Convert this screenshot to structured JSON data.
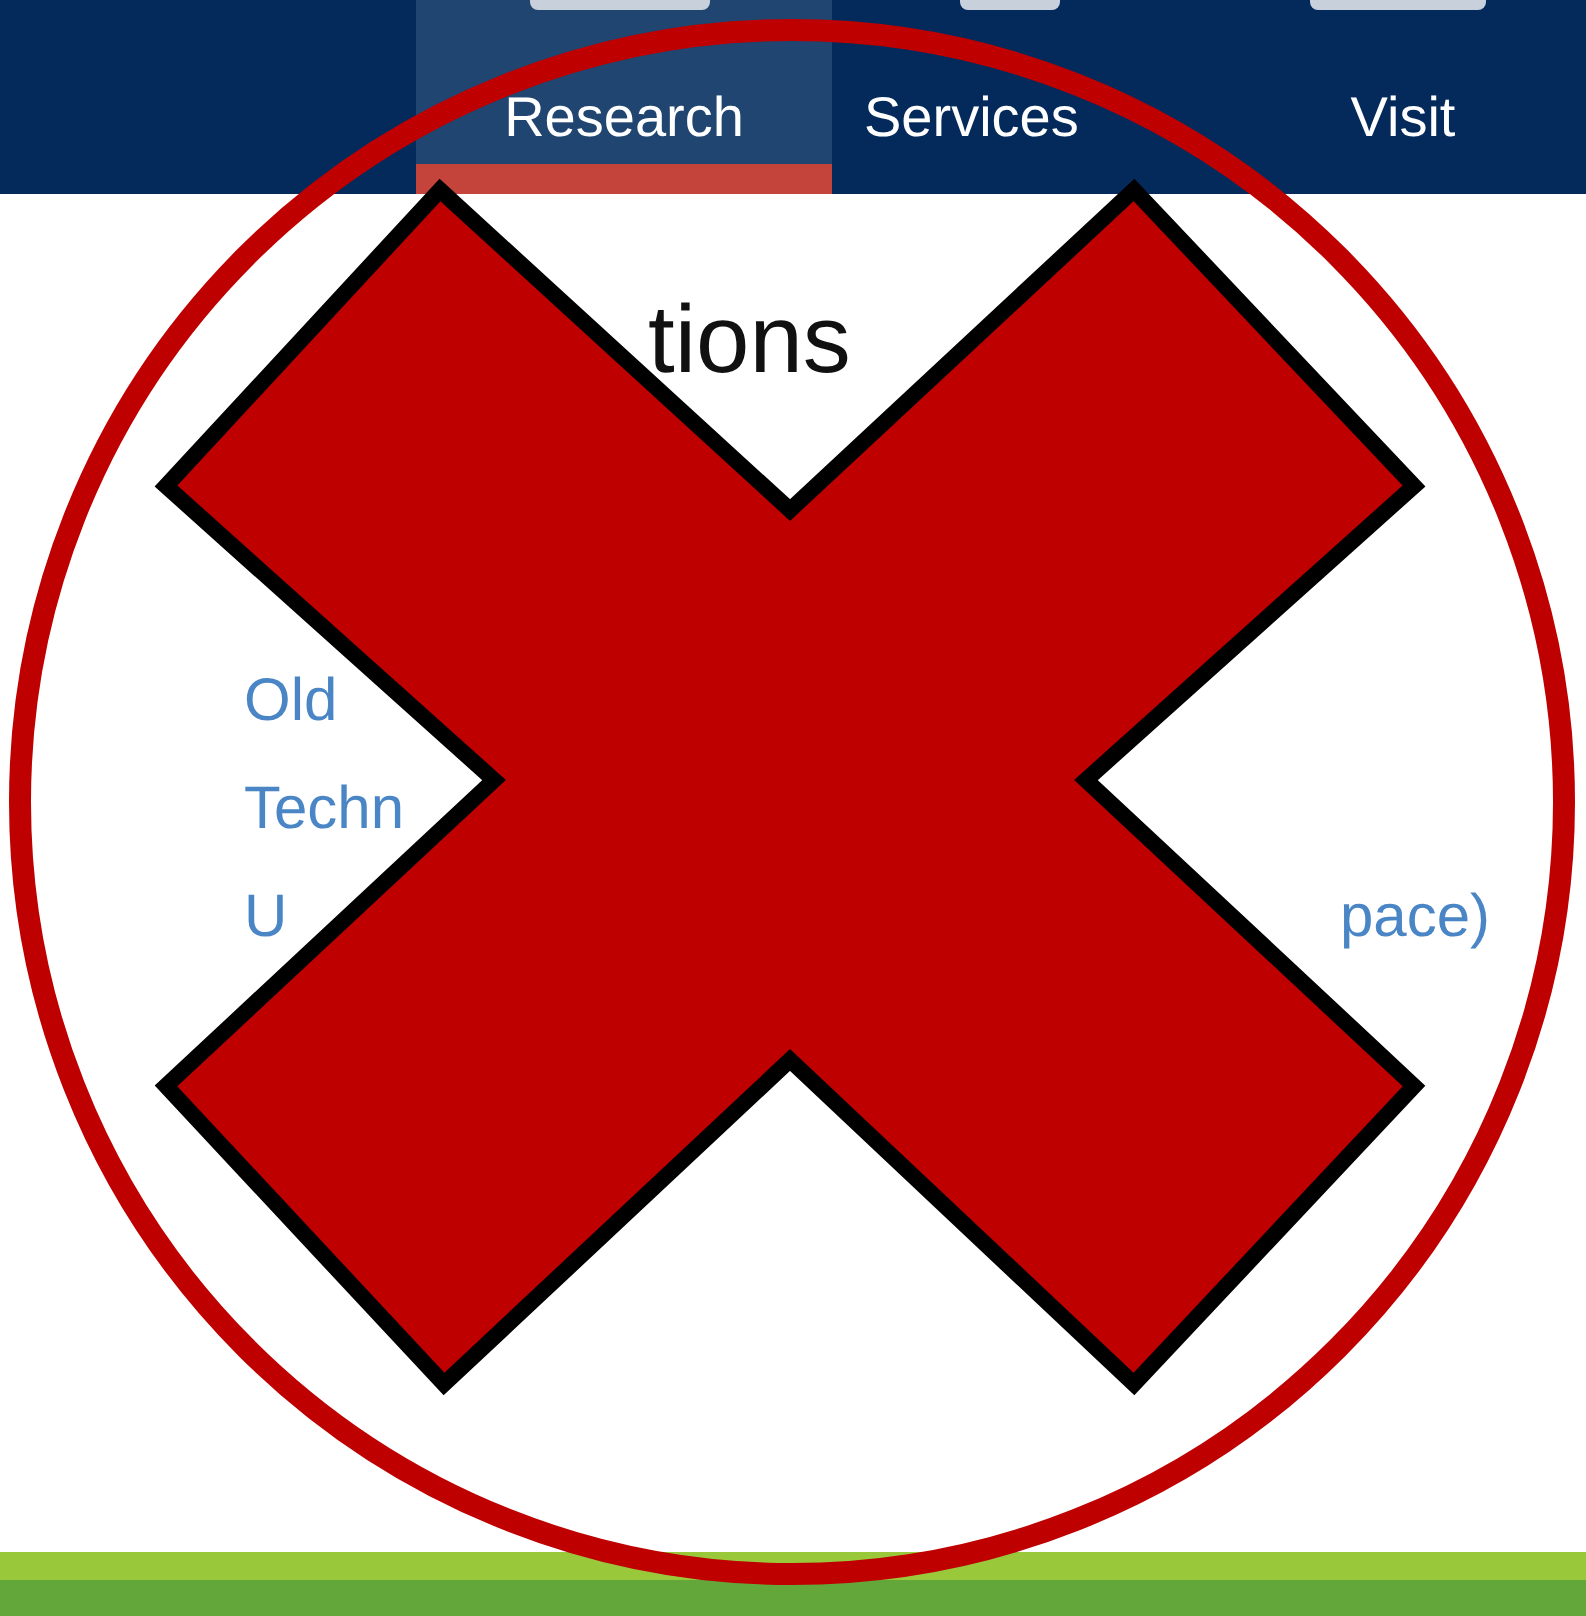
{
  "nav": [
    {
      "label": "Research",
      "selected": true
    },
    {
      "label": "Services",
      "selected": false
    },
    {
      "label": "Visit",
      "selected": false
    }
  ],
  "heading": "tions",
  "links": [
    {
      "parts": [
        "Old"
      ]
    },
    {
      "parts": [
        "Techn"
      ]
    },
    {
      "parts": [
        "U",
        "pace)"
      ]
    }
  ]
}
